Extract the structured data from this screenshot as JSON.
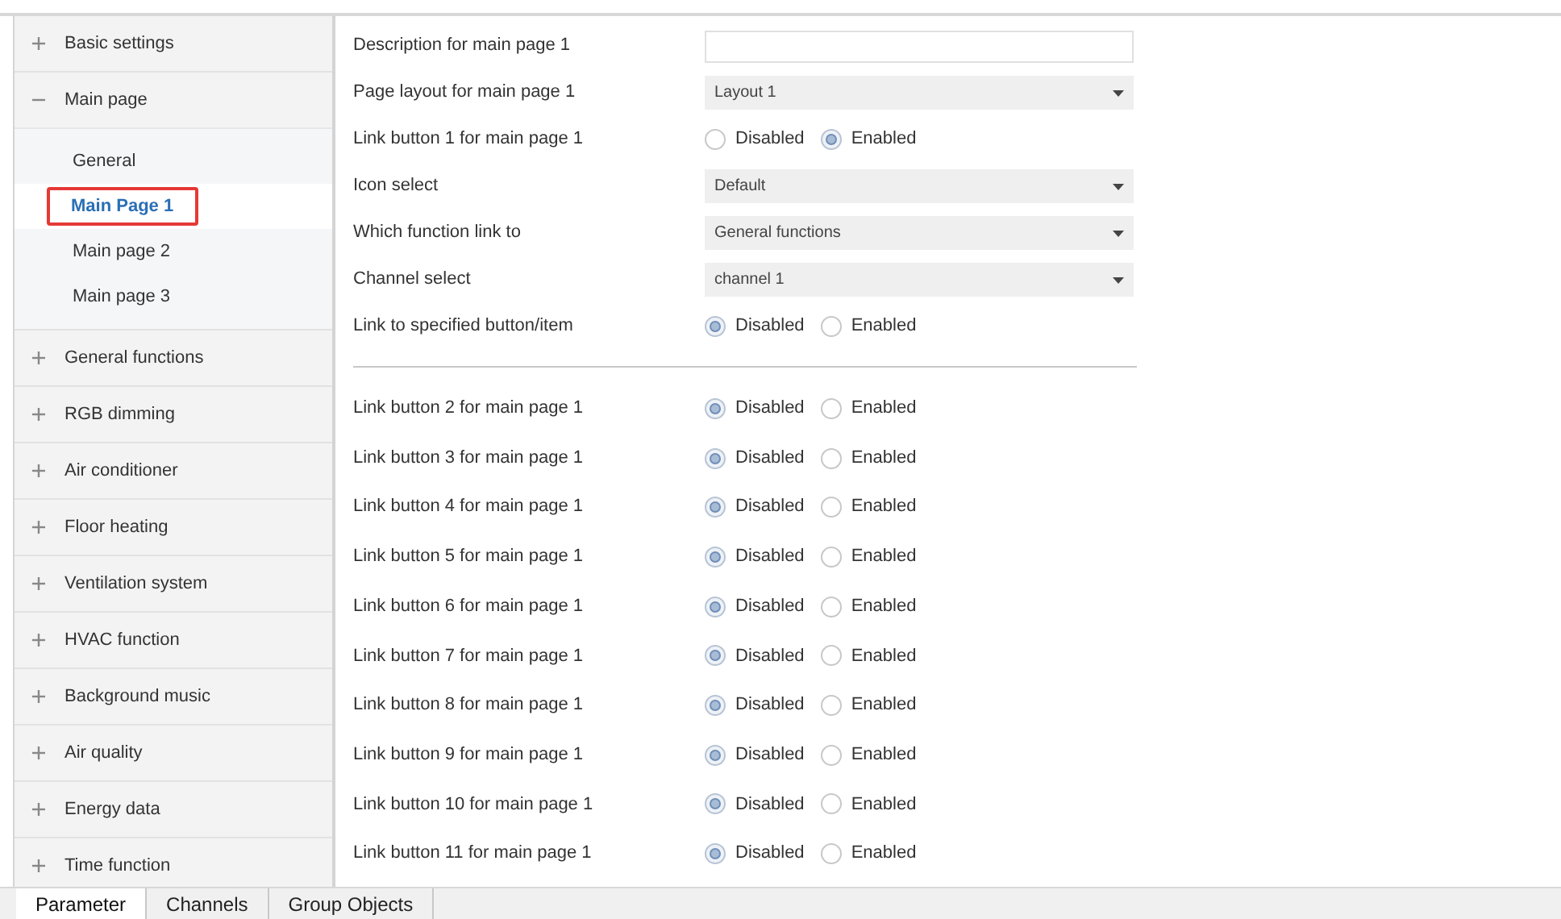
{
  "sidebar": {
    "items": [
      {
        "label": "Basic settings",
        "expanded": false
      },
      {
        "label": "Main page",
        "expanded": true,
        "children": [
          {
            "label": "General",
            "selected": false
          },
          {
            "label": "Main Page 1",
            "selected": true
          },
          {
            "label": "Main page 2",
            "selected": false
          },
          {
            "label": "Main page 3",
            "selected": false
          }
        ]
      },
      {
        "label": "General functions",
        "expanded": false
      },
      {
        "label": "RGB dimming",
        "expanded": false
      },
      {
        "label": "Air conditioner",
        "expanded": false
      },
      {
        "label": "Floor heating",
        "expanded": false
      },
      {
        "label": "Ventilation system",
        "expanded": false
      },
      {
        "label": "HVAC function",
        "expanded": false
      },
      {
        "label": "Background music",
        "expanded": false
      },
      {
        "label": "Air quality",
        "expanded": false
      },
      {
        "label": "Energy data",
        "expanded": false
      },
      {
        "label": "Time function",
        "expanded": false
      }
    ]
  },
  "parameters": [
    {
      "kind": "text",
      "label": "Description for main page 1"
    },
    {
      "kind": "select",
      "label": "Page layout for main page 1",
      "value": "Layout 1"
    },
    {
      "kind": "radio",
      "label": "Link button 1 for main page 1",
      "options": [
        {
          "label": "Disabled",
          "selected": false
        },
        {
          "label": "Enabled",
          "selected": true
        }
      ]
    },
    {
      "kind": "select",
      "label": "Icon select",
      "value": "Default"
    },
    {
      "kind": "select",
      "label": "Which function link to",
      "value": "General functions"
    },
    {
      "kind": "select",
      "label": "Channel select",
      "value": "channel 1"
    },
    {
      "kind": "radio",
      "label": "Link to specified button/item",
      "options": [
        {
          "label": "Disabled",
          "selected": true
        },
        {
          "label": "Enabled",
          "selected": false
        }
      ]
    },
    {
      "kind": "separator"
    },
    {
      "kind": "radio",
      "label": "Link button 2 for main page 1",
      "options": [
        {
          "label": "Disabled",
          "selected": true
        },
        {
          "label": "Enabled",
          "selected": false
        }
      ]
    },
    {
      "kind": "radio",
      "label": "Link button 3 for main page 1",
      "options": [
        {
          "label": "Disabled",
          "selected": true
        },
        {
          "label": "Enabled",
          "selected": false
        }
      ]
    },
    {
      "kind": "radio",
      "label": "Link button 4 for main page 1",
      "options": [
        {
          "label": "Disabled",
          "selected": true
        },
        {
          "label": "Enabled",
          "selected": false
        }
      ]
    },
    {
      "kind": "radio",
      "label": "Link button 5 for main page 1",
      "options": [
        {
          "label": "Disabled",
          "selected": true
        },
        {
          "label": "Enabled",
          "selected": false
        }
      ]
    },
    {
      "kind": "radio",
      "label": "Link button 6 for main page 1",
      "options": [
        {
          "label": "Disabled",
          "selected": true
        },
        {
          "label": "Enabled",
          "selected": false
        }
      ]
    },
    {
      "kind": "radio",
      "label": "Link button 7 for main page 1",
      "options": [
        {
          "label": "Disabled",
          "selected": true
        },
        {
          "label": "Enabled",
          "selected": false
        }
      ]
    },
    {
      "kind": "radio",
      "label": "Link button 8 for main page 1",
      "options": [
        {
          "label": "Disabled",
          "selected": true
        },
        {
          "label": "Enabled",
          "selected": false
        }
      ]
    },
    {
      "kind": "radio",
      "label": "Link button 9 for main page 1",
      "options": [
        {
          "label": "Disabled",
          "selected": true
        },
        {
          "label": "Enabled",
          "selected": false
        }
      ]
    },
    {
      "kind": "radio",
      "label": "Link button 10 for main page 1",
      "options": [
        {
          "label": "Disabled",
          "selected": true
        },
        {
          "label": "Enabled",
          "selected": false
        }
      ]
    },
    {
      "kind": "radio",
      "label": "Link button 11 for main page 1",
      "options": [
        {
          "label": "Disabled",
          "selected": true
        },
        {
          "label": "Enabled",
          "selected": false
        }
      ]
    }
  ],
  "tabs": [
    {
      "label": "Parameter",
      "selected": true
    },
    {
      "label": "Channels",
      "selected": false
    },
    {
      "label": "Group Objects",
      "selected": false
    }
  ]
}
